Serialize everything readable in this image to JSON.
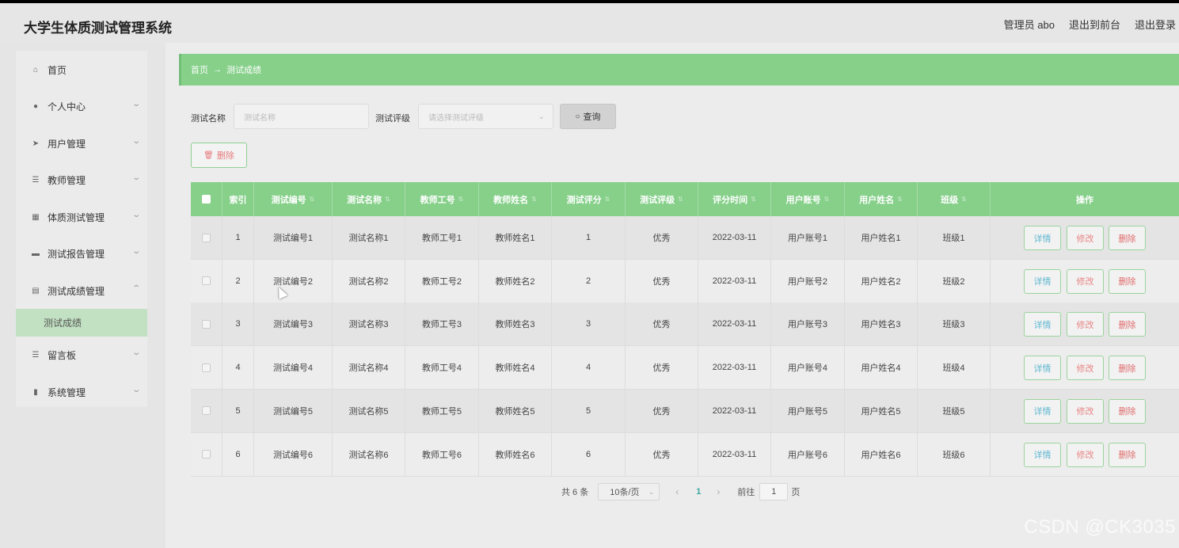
{
  "app": {
    "title": "大学生体质测试管理系统"
  },
  "top_links": {
    "admin": "管理员 abo",
    "front": "退出到前台",
    "logout": "退出登录"
  },
  "sidebar": {
    "items": [
      {
        "label": "首页",
        "icon": "home-icon"
      },
      {
        "label": "个人中心",
        "icon": "user-icon"
      },
      {
        "label": "用户管理",
        "icon": "send-icon"
      },
      {
        "label": "教师管理",
        "icon": "menu-icon"
      },
      {
        "label": "体质测试管理",
        "icon": "grid-icon"
      },
      {
        "label": "测试报告管理",
        "icon": "monitor-icon"
      },
      {
        "label": "测试成绩管理",
        "icon": "document-icon"
      },
      {
        "label": "留言板",
        "icon": "menu-icon"
      },
      {
        "label": "系统管理",
        "icon": "chart-icon"
      }
    ],
    "sub_active": "测试成绩"
  },
  "breadcrumb": {
    "home": "首页",
    "arrow": "→",
    "current": "测试成绩"
  },
  "filters": {
    "name_label": "测试名称",
    "name_placeholder": "测试名称",
    "grade_label": "测试评级",
    "grade_placeholder": "请选择测试评级",
    "query_label": "查询"
  },
  "actions": {
    "delete_label": "删除"
  },
  "table": {
    "headers": [
      "索引",
      "测试编号",
      "测试名称",
      "教师工号",
      "教师姓名",
      "测试评分",
      "测试评级",
      "评分时间",
      "用户账号",
      "用户姓名",
      "班级",
      "操作"
    ],
    "rows": [
      [
        "1",
        "测试编号1",
        "测试名称1",
        "教师工号1",
        "教师姓名1",
        "1",
        "优秀",
        "2022-03-11",
        "用户账号1",
        "用户姓名1",
        "班级1"
      ],
      [
        "2",
        "测试编号2",
        "测试名称2",
        "教师工号2",
        "教师姓名2",
        "2",
        "优秀",
        "2022-03-11",
        "用户账号2",
        "用户姓名2",
        "班级2"
      ],
      [
        "3",
        "测试编号3",
        "测试名称3",
        "教师工号3",
        "教师姓名3",
        "3",
        "优秀",
        "2022-03-11",
        "用户账号3",
        "用户姓名3",
        "班级3"
      ],
      [
        "4",
        "测试编号4",
        "测试名称4",
        "教师工号4",
        "教师姓名4",
        "4",
        "优秀",
        "2022-03-11",
        "用户账号4",
        "用户姓名4",
        "班级4"
      ],
      [
        "5",
        "测试编号5",
        "测试名称5",
        "教师工号5",
        "教师姓名5",
        "5",
        "优秀",
        "2022-03-11",
        "用户账号5",
        "用户姓名5",
        "班级5"
      ],
      [
        "6",
        "测试编号6",
        "测试名称6",
        "教师工号6",
        "教师姓名6",
        "6",
        "优秀",
        "2022-03-11",
        "用户账号6",
        "用户姓名6",
        "班级6"
      ]
    ],
    "op_labels": {
      "detail": "详情",
      "edit": "修改",
      "remove": "删除"
    }
  },
  "pagination": {
    "total": "共 6 条",
    "page_size": "10条/页",
    "current": "1",
    "goto_label": "前往",
    "goto_value": "1",
    "page_unit": "页"
  },
  "watermark": "CSDN @CK3035"
}
